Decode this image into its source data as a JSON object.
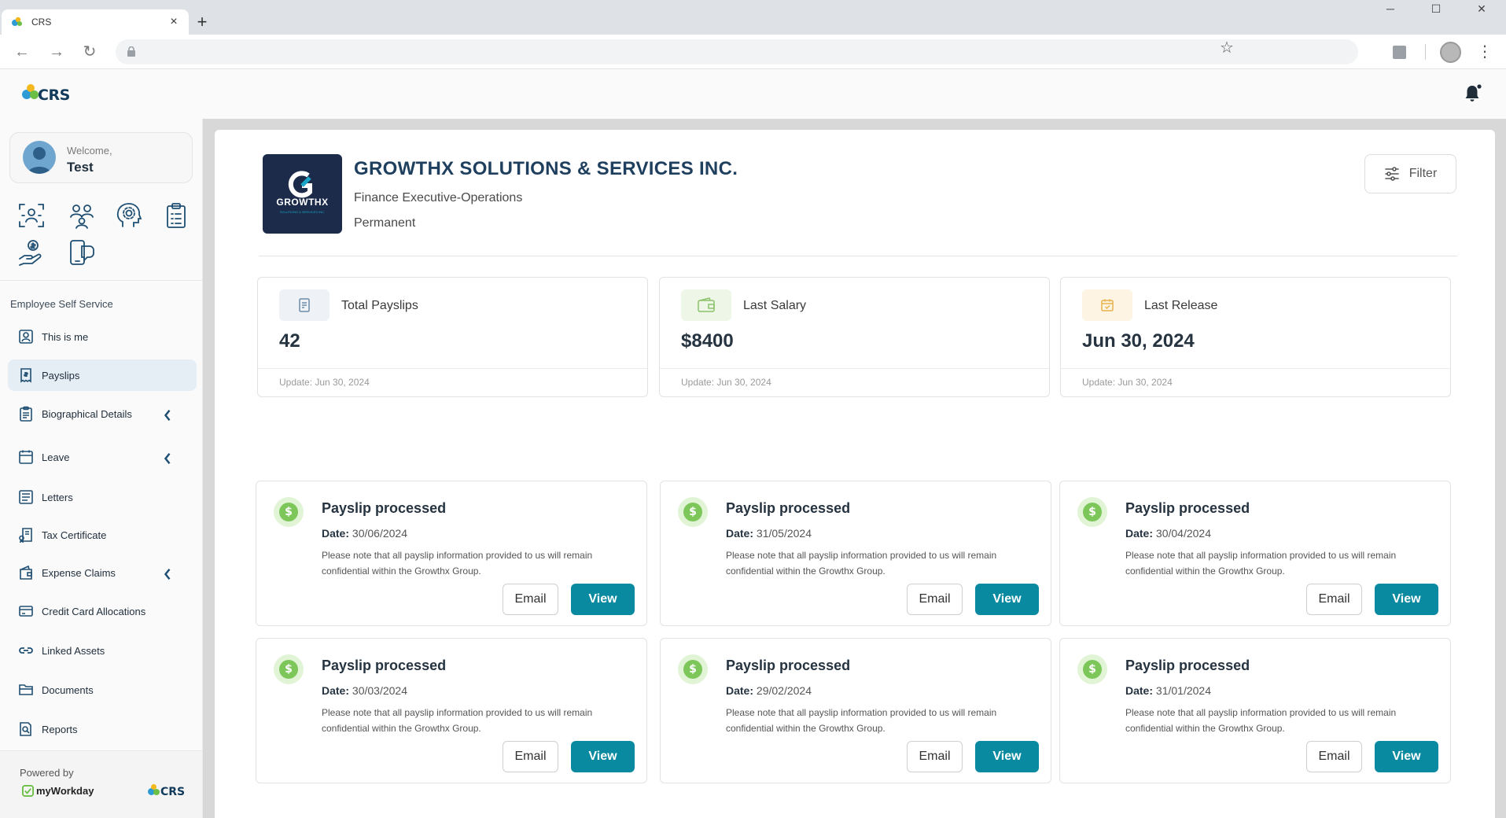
{
  "browser": {
    "tab_title": "CRS",
    "new_tab": "+",
    "tab_close": "×",
    "window_minimize": "─",
    "window_maximize": "☐",
    "window_close": "✕"
  },
  "app": {
    "logo_text": "CRS"
  },
  "sidebar": {
    "welcome_label": "Welcome,",
    "user_name": "Test",
    "quick_icons": [
      "face-scan-icon",
      "team-icon",
      "mind-gear-icon",
      "clipboard-icon",
      "hand-dollar-icon",
      "device-chat-icon"
    ],
    "section_title": "Employee Self Service",
    "items": [
      {
        "label": "This is me",
        "icon": "id-card-icon",
        "active": false,
        "expandable": false
      },
      {
        "label": "Payslips",
        "icon": "payslip-icon",
        "active": true,
        "expandable": false
      },
      {
        "label": "Biographical Details",
        "icon": "clipboard-list-icon",
        "active": false,
        "expandable": true
      },
      {
        "label": "Leave",
        "icon": "calendar-icon",
        "active": false,
        "expandable": true
      },
      {
        "label": "Letters",
        "icon": "letter-icon",
        "active": false,
        "expandable": false
      },
      {
        "label": "Tax Certificate",
        "icon": "certificate-icon",
        "active": false,
        "expandable": false
      },
      {
        "label": "Expense Claims",
        "icon": "wallet-icon",
        "active": false,
        "expandable": true
      },
      {
        "label": "Credit Card Allocations",
        "icon": "credit-card-icon",
        "active": false,
        "expandable": false
      },
      {
        "label": "Linked Assets",
        "icon": "link-icon",
        "active": false,
        "expandable": false
      },
      {
        "label": "Documents",
        "icon": "folder-icon",
        "active": false,
        "expandable": false
      },
      {
        "label": "Reports",
        "icon": "report-icon",
        "active": false,
        "expandable": false
      }
    ],
    "powered_by": "Powered by",
    "myworkday": "myWorkday",
    "crs_small": "CRS"
  },
  "company": {
    "logo_text": "GROWTHX",
    "logo_sub": "SOLUTIONS & SERVICES INC.",
    "name": "GROWTHX SOLUTIONS & SERVICES INC.",
    "role": "Finance Executive-Operations",
    "type": "Permanent"
  },
  "filter_label": "Filter",
  "stats": [
    {
      "label": "Total Payslips",
      "value": "42",
      "update": "Update: Jun 30, 2024",
      "icon": "document-icon",
      "accent": "#eef2f6"
    },
    {
      "label": "Last Salary",
      "value": "$8400",
      "update": "Update: Jun 30, 2024",
      "icon": "wallet-icon",
      "accent": "#eef6e8"
    },
    {
      "label": "Last Release",
      "value": "Jun 30, 2024",
      "update": "Update: Jun 30, 2024",
      "icon": "calendar-icon",
      "accent": "#fdf4e4"
    }
  ],
  "payslips": [
    {
      "title": "Payslip processed",
      "date_label": "Date:",
      "date": "30/06/2024",
      "note": "Please note that all payslip information provided to us will remain confidential within the Growthx Group.",
      "email": "Email",
      "view": "View"
    },
    {
      "title": "Payslip processed",
      "date_label": "Date:",
      "date": "31/05/2024",
      "note": "Please note that all payslip information provided to us will remain confidential within the Growthx Group.",
      "email": "Email",
      "view": "View"
    },
    {
      "title": "Payslip processed",
      "date_label": "Date:",
      "date": "30/04/2024",
      "note": "Please note that all payslip information provided to us will remain confidential within the Growthx Group.",
      "email": "Email",
      "view": "View"
    },
    {
      "title": "Payslip processed",
      "date_label": "Date:",
      "date": "30/03/2024",
      "note": "Please note that all payslip information provided to us will remain confidential within the Growthx Group.",
      "email": "Email",
      "view": "View"
    },
    {
      "title": "Payslip processed",
      "date_label": "Date:",
      "date": "29/02/2024",
      "note": "Please note that all payslip information provided to us will remain confidential within the Growthx Group.",
      "email": "Email",
      "view": "View"
    },
    {
      "title": "Payslip processed",
      "date_label": "Date:",
      "date": "31/01/2024",
      "note": "Please note that all payslip information provided to us will remain confidential within the Growthx Group.",
      "email": "Email",
      "view": "View"
    }
  ],
  "colors": {
    "accent_teal": "#0a8aa0",
    "brand_navy": "#1c2b4a",
    "active_nav_bg": "#e6eef5",
    "payslip_icon_green": "#7cc65a"
  }
}
